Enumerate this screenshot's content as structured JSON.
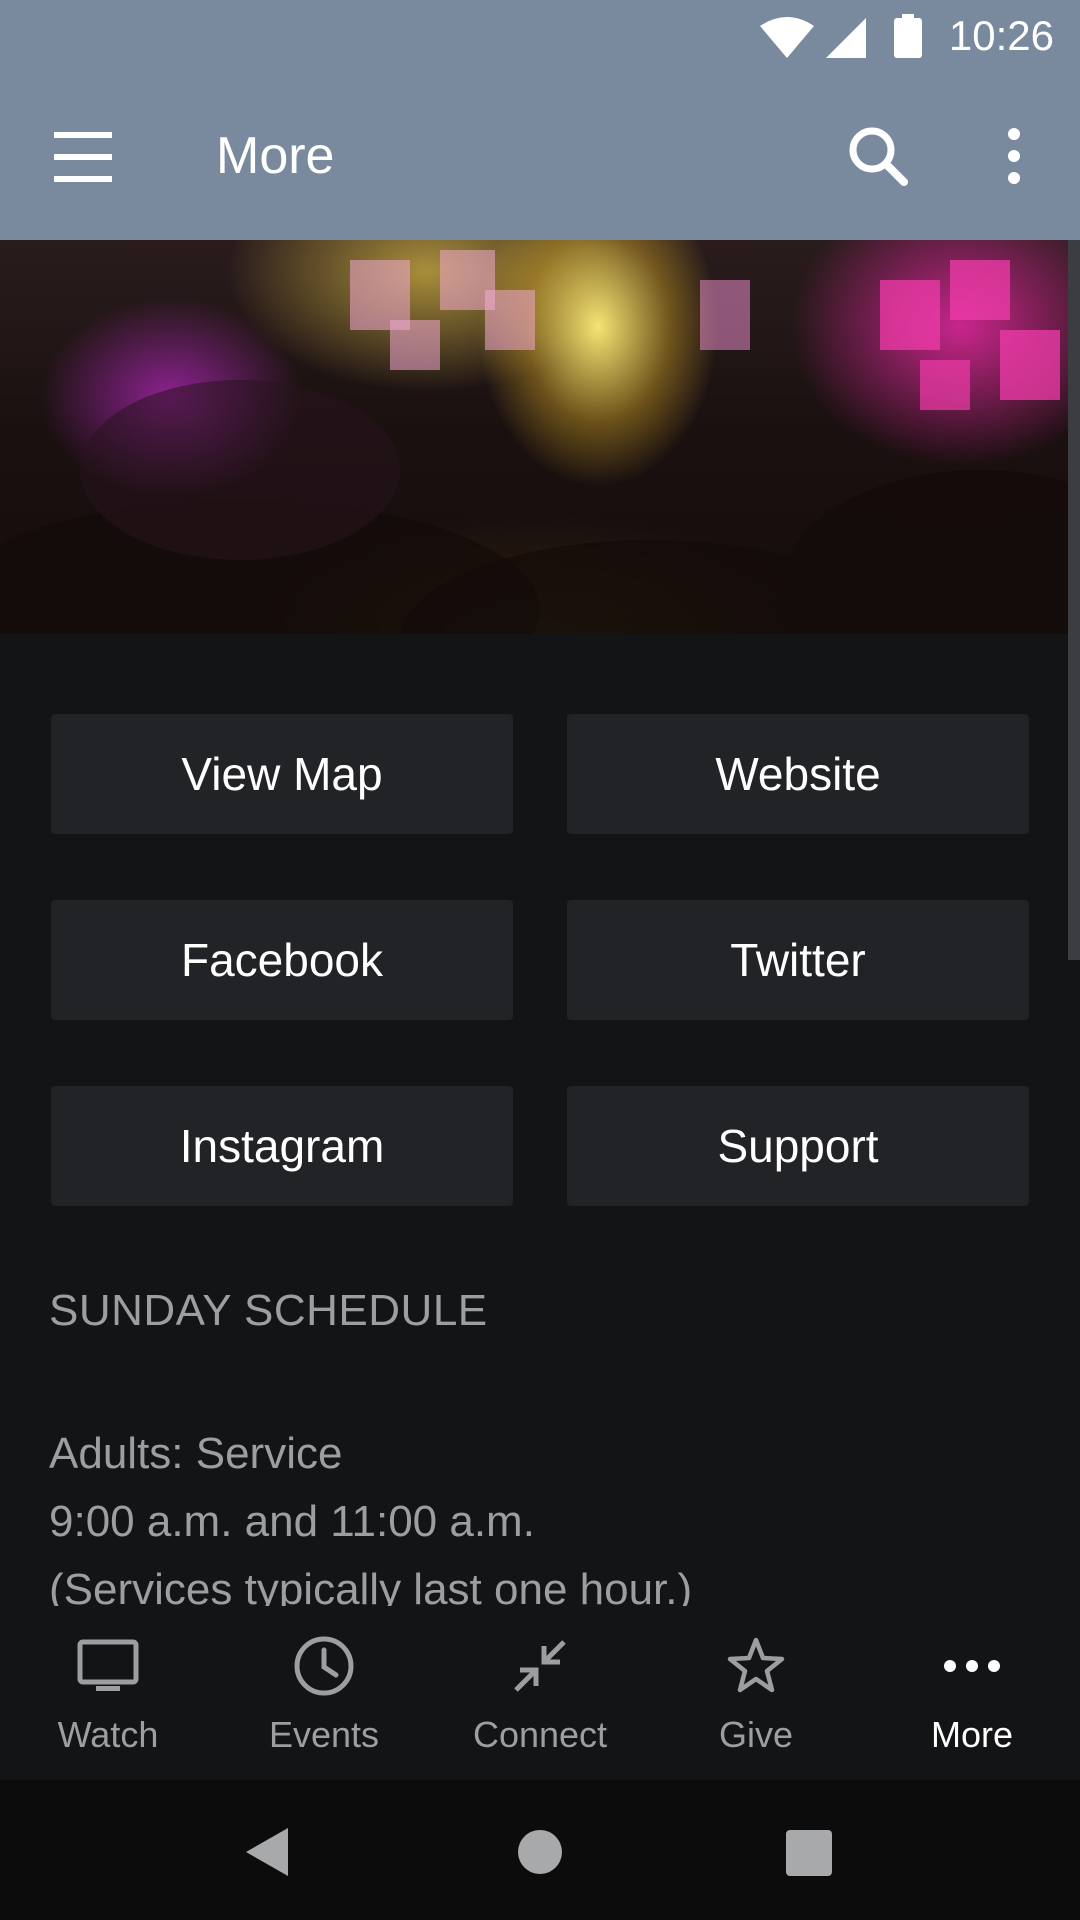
{
  "status_bar": {
    "time": "10:26",
    "icons": [
      "wifi-icon",
      "cell-signal-icon",
      "battery-icon"
    ]
  },
  "app_bar": {
    "title": "More",
    "icons": [
      "menu-icon",
      "search-icon",
      "overflow-menu-icon"
    ],
    "background_color": "#7a8a9e"
  },
  "hero_image": {
    "description_icon": "concert-photo"
  },
  "links": [
    {
      "label": "View Map"
    },
    {
      "label": "Website"
    },
    {
      "label": "Facebook"
    },
    {
      "label": "Twitter"
    },
    {
      "label": "Instagram"
    },
    {
      "label": "Support"
    }
  ],
  "schedule": {
    "title": "SUNDAY SCHEDULE",
    "lines": [
      "Adults: Service",
      "9:00 a.m. and 11:00 a.m.",
      "(Services typically last one hour.)"
    ]
  },
  "bottom_nav": {
    "items": [
      {
        "label": "Watch",
        "icon": "tv-icon"
      },
      {
        "label": "Events",
        "icon": "clock-icon"
      },
      {
        "label": "Connect",
        "icon": "arrows-inward-icon"
      },
      {
        "label": "Give",
        "icon": "star-icon"
      },
      {
        "label": "More",
        "icon": "more-dots-icon"
      }
    ],
    "active": "More"
  },
  "system_nav": {
    "icons": [
      "back-icon",
      "home-icon",
      "recents-icon"
    ]
  },
  "colors": {
    "background": "#131416",
    "button": "#222326",
    "muted_text": "#9c9ea2"
  }
}
